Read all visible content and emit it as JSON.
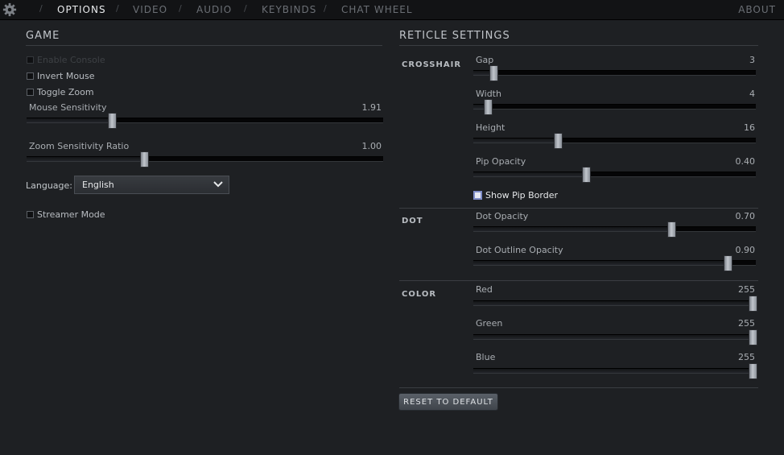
{
  "nav": {
    "tabs": [
      "OPTIONS",
      "VIDEO",
      "AUDIO",
      "KEYBINDS",
      "CHAT WHEEL"
    ],
    "active": "OPTIONS",
    "about": "ABOUT",
    "separator": "/"
  },
  "game": {
    "title": "GAME",
    "enable_console": {
      "label": "Enable Console",
      "checked": false,
      "disabled": true
    },
    "invert_mouse": {
      "label": "Invert Mouse",
      "checked": false
    },
    "toggle_zoom": {
      "label": "Toggle Zoom",
      "checked": false
    },
    "mouse_sensitivity": {
      "label": "Mouse Sensitivity",
      "value": "1.91",
      "fraction": 0.24
    },
    "zoom_sensitivity_ratio": {
      "label": "Zoom Sensitivity Ratio",
      "value": "1.00",
      "fraction": 0.33
    },
    "language": {
      "label": "Language:",
      "value": "English"
    },
    "streamer_mode": {
      "label": "Streamer Mode",
      "checked": false
    }
  },
  "reticle": {
    "title": "RETICLE SETTINGS",
    "crosshair": {
      "label": "CROSSHAIR",
      "gap": {
        "label": "Gap",
        "value": "3",
        "fraction": 0.07
      },
      "width": {
        "label": "Width",
        "value": "4",
        "fraction": 0.05
      },
      "height": {
        "label": "Height",
        "value": "16",
        "fraction": 0.3
      },
      "pip_opacity": {
        "label": "Pip Opacity",
        "value": "0.40",
        "fraction": 0.4
      },
      "show_pip_border": {
        "label": "Show Pip Border",
        "checked": false
      }
    },
    "dot": {
      "label": "DOT",
      "dot_opacity": {
        "label": "Dot Opacity",
        "value": "0.70",
        "fraction": 0.7
      },
      "dot_outline_opacity": {
        "label": "Dot Outline Opacity",
        "value": "0.90",
        "fraction": 0.9
      }
    },
    "color": {
      "label": "COLOR",
      "red": {
        "label": "Red",
        "value": "255",
        "fraction": 1.0
      },
      "green": {
        "label": "Green",
        "value": "255",
        "fraction": 1.0
      },
      "blue": {
        "label": "Blue",
        "value": "255",
        "fraction": 1.0
      }
    },
    "reset_label": "RESET TO DEFAULT"
  }
}
